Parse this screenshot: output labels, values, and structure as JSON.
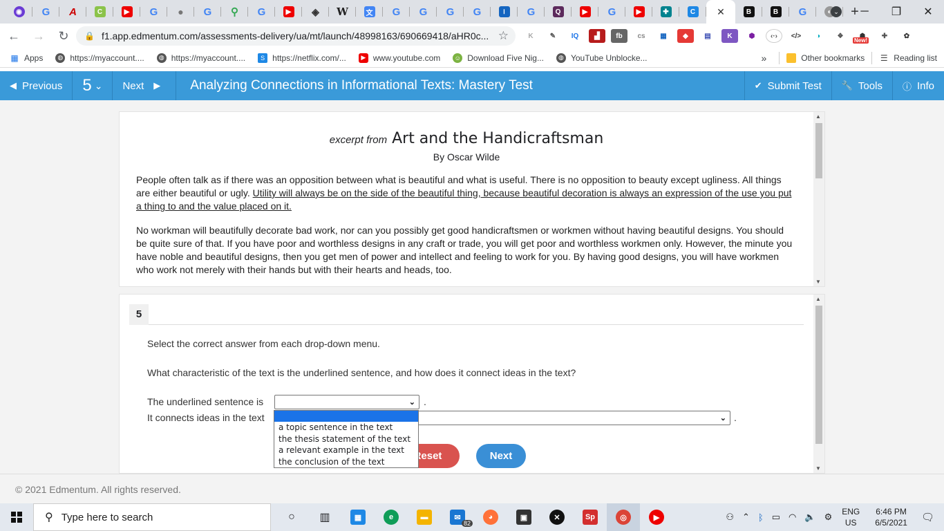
{
  "browser": {
    "url": "f1.app.edmentum.com/assessments-delivery/ua/mt/launch/48998163/690669418/aHR0c...",
    "tab_close": "✕",
    "new_tab": "+",
    "bookmarks": [
      {
        "label": "Apps"
      },
      {
        "label": "https://myaccount...."
      },
      {
        "label": "https://myaccount...."
      },
      {
        "label": "https://netflix.com/..."
      },
      {
        "label": "www.youtube.com"
      },
      {
        "label": "Download Five Nig..."
      },
      {
        "label": "YouTube Unblocke..."
      }
    ],
    "bookmarks_overflow": "»",
    "other_bookmarks": "Other bookmarks",
    "reading_list": "Reading list",
    "extension_badge": "New!",
    "colors": {
      "tabstrip": "#dee1e6",
      "accent": "#1a73e8"
    }
  },
  "app": {
    "prev_label": "Previous",
    "question_number": "5",
    "next_label": "Next",
    "title": "Analyzing Connections in Informational Texts: Mastery Test",
    "submit_label": "Submit Test",
    "tools_label": "Tools",
    "info_label": "Info",
    "header_color": "#3a9ad9"
  },
  "passage": {
    "excerpt_label": "excerpt from",
    "title": "Art and the Handicraftsman",
    "author": "By Oscar Wilde",
    "para1_plain": "People often talk as if there was an opposition between what is beautiful and what is useful. There is no opposition to beauty except ugliness. All things are either beautiful or ugly. ",
    "para1_underlined": "Utility will always be on the side of the beautiful thing, because beautiful decoration is always an expression of the use you put a thing to and the value placed on it.",
    "para2": "No workman will beautifully decorate bad work, nor can you possibly get good handicraftsmen or workmen without having beautiful designs. You should be quite sure of that. If you have poor and worthless designs in any craft or trade, you will get poor and worthless workmen only. However, the minute you have noble and beautiful designs, then you get men of power and intellect and feeling to work for you. By having good designs, you will have workmen who work not merely with their hands but with their hearts and heads, too."
  },
  "question": {
    "number": "5",
    "instruction": "Select the correct answer from each drop-down menu.",
    "prompt": "What characteristic of the text is the underlined sentence, and how does it connect ideas in the text?",
    "line1_label": "The underlined sentence is",
    "line2_label": "It connects ideas in the text",
    "period": ".",
    "dropdown1_options": [
      "",
      "a topic sentence in the text",
      "the thesis statement of the text",
      "a relevant example in the text",
      "the conclusion of the text"
    ],
    "reset_label": "Reset",
    "next_label": "Next",
    "reset_color": "#d9534f",
    "next_color": "#3a8fd6"
  },
  "footer": {
    "copyright": "© 2021 Edmentum. All rights reserved."
  },
  "taskbar": {
    "search_placeholder": "Type here to search",
    "mail_badge": "82",
    "lang_top": "ENG",
    "lang_bottom": "US",
    "time": "6:46 PM",
    "date": "6/5/2021"
  }
}
